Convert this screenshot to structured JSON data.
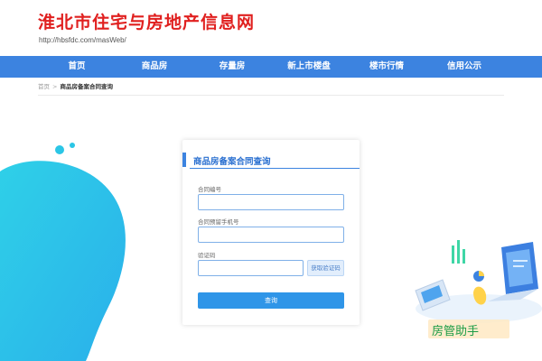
{
  "header": {
    "site_title": "淮北市住宅与房地产信息网",
    "site_url": "http://hbsfdc.com/masWeb/"
  },
  "nav": {
    "items": [
      {
        "label": "首页"
      },
      {
        "label": "商品房"
      },
      {
        "label": "存量房"
      },
      {
        "label": "新上市楼盘"
      },
      {
        "label": "楼市行情"
      },
      {
        "label": "信用公示"
      }
    ]
  },
  "breadcrumb": {
    "home": "首页",
    "separator": ">",
    "current": "商品房备案合同查询"
  },
  "form": {
    "title": "商品房备案合同查询",
    "contract_no_label": "合同编号",
    "contract_no_value": "",
    "phone_label": "合同预留手机号",
    "phone_value": "",
    "captcha_label": "验证码",
    "captcha_value": "",
    "get_captcha_label": "获取验证码",
    "submit_label": "查询"
  },
  "watermark": {
    "text": "房管助手"
  },
  "colors": {
    "title_red": "#e0201f",
    "nav_blue": "#3c83e0",
    "button_blue": "#2f95e8",
    "deco_cyan": "#2fd0e8",
    "watermark_green": "#1c9c46"
  }
}
